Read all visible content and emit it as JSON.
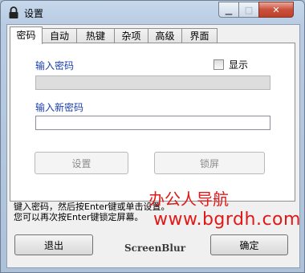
{
  "window": {
    "title": "设置",
    "minimize_glyph": "▁",
    "maximize_glyph": "□",
    "close_glyph": "✕"
  },
  "tabs": [
    {
      "label": "密码",
      "active": true
    },
    {
      "label": "自动"
    },
    {
      "label": "热键"
    },
    {
      "label": "杂项"
    },
    {
      "label": "高级"
    },
    {
      "label": "界面"
    }
  ],
  "password_tab": {
    "enter_password_label": "输入密码",
    "show_checkbox_label": "显示",
    "show_checked": false,
    "password_value": "",
    "new_password_label": "输入新密码",
    "new_password_value": "",
    "settings_button": "设置",
    "lock_button": "锁屏"
  },
  "info_lines": [
    "键入密码，然后按Enter键或单击设置。",
    "您可以再次按Enter键锁定屏幕。"
  ],
  "watermark": {
    "line1": "办公人导航",
    "line2": "www.bgrdh.com"
  },
  "footer": {
    "exit_button": "退出",
    "brand": "ScreenBlur",
    "ok_button": "确定"
  },
  "colors": {
    "title_blue_label": "#1b3fae",
    "watermark_red": "#e01818",
    "close_red": "#c9503b"
  }
}
